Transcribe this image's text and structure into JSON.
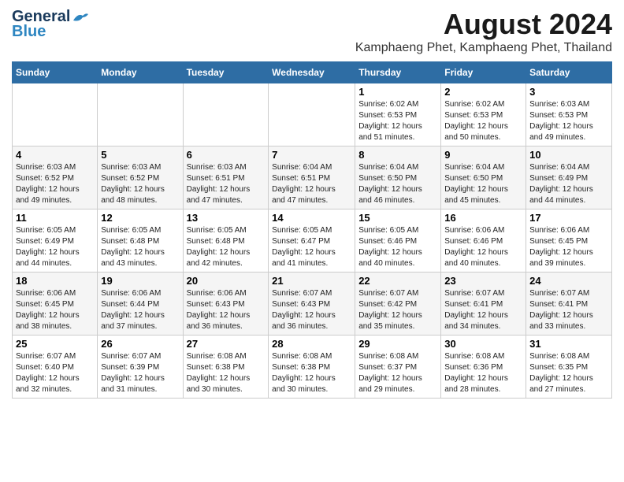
{
  "header": {
    "logo_line1": "General",
    "logo_line2": "Blue",
    "title": "August 2024",
    "subtitle": "Kamphaeng Phet, Kamphaeng Phet, Thailand"
  },
  "weekdays": [
    "Sunday",
    "Monday",
    "Tuesday",
    "Wednesday",
    "Thursday",
    "Friday",
    "Saturday"
  ],
  "weeks": [
    [
      {
        "day": "",
        "info": ""
      },
      {
        "day": "",
        "info": ""
      },
      {
        "day": "",
        "info": ""
      },
      {
        "day": "",
        "info": ""
      },
      {
        "day": "1",
        "info": "Sunrise: 6:02 AM\nSunset: 6:53 PM\nDaylight: 12 hours\nand 51 minutes."
      },
      {
        "day": "2",
        "info": "Sunrise: 6:02 AM\nSunset: 6:53 PM\nDaylight: 12 hours\nand 50 minutes."
      },
      {
        "day": "3",
        "info": "Sunrise: 6:03 AM\nSunset: 6:53 PM\nDaylight: 12 hours\nand 49 minutes."
      }
    ],
    [
      {
        "day": "4",
        "info": "Sunrise: 6:03 AM\nSunset: 6:52 PM\nDaylight: 12 hours\nand 49 minutes."
      },
      {
        "day": "5",
        "info": "Sunrise: 6:03 AM\nSunset: 6:52 PM\nDaylight: 12 hours\nand 48 minutes."
      },
      {
        "day": "6",
        "info": "Sunrise: 6:03 AM\nSunset: 6:51 PM\nDaylight: 12 hours\nand 47 minutes."
      },
      {
        "day": "7",
        "info": "Sunrise: 6:04 AM\nSunset: 6:51 PM\nDaylight: 12 hours\nand 47 minutes."
      },
      {
        "day": "8",
        "info": "Sunrise: 6:04 AM\nSunset: 6:50 PM\nDaylight: 12 hours\nand 46 minutes."
      },
      {
        "day": "9",
        "info": "Sunrise: 6:04 AM\nSunset: 6:50 PM\nDaylight: 12 hours\nand 45 minutes."
      },
      {
        "day": "10",
        "info": "Sunrise: 6:04 AM\nSunset: 6:49 PM\nDaylight: 12 hours\nand 44 minutes."
      }
    ],
    [
      {
        "day": "11",
        "info": "Sunrise: 6:05 AM\nSunset: 6:49 PM\nDaylight: 12 hours\nand 44 minutes."
      },
      {
        "day": "12",
        "info": "Sunrise: 6:05 AM\nSunset: 6:48 PM\nDaylight: 12 hours\nand 43 minutes."
      },
      {
        "day": "13",
        "info": "Sunrise: 6:05 AM\nSunset: 6:48 PM\nDaylight: 12 hours\nand 42 minutes."
      },
      {
        "day": "14",
        "info": "Sunrise: 6:05 AM\nSunset: 6:47 PM\nDaylight: 12 hours\nand 41 minutes."
      },
      {
        "day": "15",
        "info": "Sunrise: 6:05 AM\nSunset: 6:46 PM\nDaylight: 12 hours\nand 40 minutes."
      },
      {
        "day": "16",
        "info": "Sunrise: 6:06 AM\nSunset: 6:46 PM\nDaylight: 12 hours\nand 40 minutes."
      },
      {
        "day": "17",
        "info": "Sunrise: 6:06 AM\nSunset: 6:45 PM\nDaylight: 12 hours\nand 39 minutes."
      }
    ],
    [
      {
        "day": "18",
        "info": "Sunrise: 6:06 AM\nSunset: 6:45 PM\nDaylight: 12 hours\nand 38 minutes."
      },
      {
        "day": "19",
        "info": "Sunrise: 6:06 AM\nSunset: 6:44 PM\nDaylight: 12 hours\nand 37 minutes."
      },
      {
        "day": "20",
        "info": "Sunrise: 6:06 AM\nSunset: 6:43 PM\nDaylight: 12 hours\nand 36 minutes."
      },
      {
        "day": "21",
        "info": "Sunrise: 6:07 AM\nSunset: 6:43 PM\nDaylight: 12 hours\nand 36 minutes."
      },
      {
        "day": "22",
        "info": "Sunrise: 6:07 AM\nSunset: 6:42 PM\nDaylight: 12 hours\nand 35 minutes."
      },
      {
        "day": "23",
        "info": "Sunrise: 6:07 AM\nSunset: 6:41 PM\nDaylight: 12 hours\nand 34 minutes."
      },
      {
        "day": "24",
        "info": "Sunrise: 6:07 AM\nSunset: 6:41 PM\nDaylight: 12 hours\nand 33 minutes."
      }
    ],
    [
      {
        "day": "25",
        "info": "Sunrise: 6:07 AM\nSunset: 6:40 PM\nDaylight: 12 hours\nand 32 minutes."
      },
      {
        "day": "26",
        "info": "Sunrise: 6:07 AM\nSunset: 6:39 PM\nDaylight: 12 hours\nand 31 minutes."
      },
      {
        "day": "27",
        "info": "Sunrise: 6:08 AM\nSunset: 6:38 PM\nDaylight: 12 hours\nand 30 minutes."
      },
      {
        "day": "28",
        "info": "Sunrise: 6:08 AM\nSunset: 6:38 PM\nDaylight: 12 hours\nand 30 minutes."
      },
      {
        "day": "29",
        "info": "Sunrise: 6:08 AM\nSunset: 6:37 PM\nDaylight: 12 hours\nand 29 minutes."
      },
      {
        "day": "30",
        "info": "Sunrise: 6:08 AM\nSunset: 6:36 PM\nDaylight: 12 hours\nand 28 minutes."
      },
      {
        "day": "31",
        "info": "Sunrise: 6:08 AM\nSunset: 6:35 PM\nDaylight: 12 hours\nand 27 minutes."
      }
    ]
  ]
}
